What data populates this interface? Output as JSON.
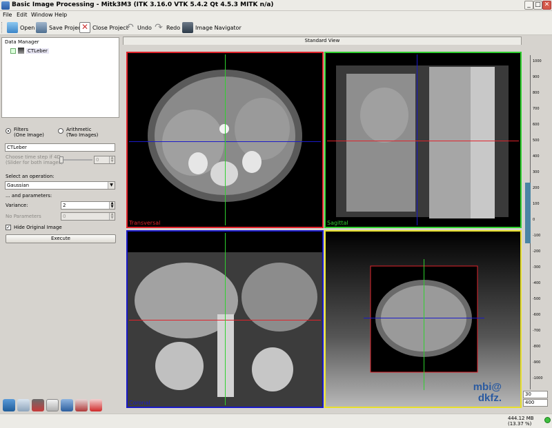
{
  "window": {
    "title": "Basic Image Processing - Mitk3M3 (ITK 3.16.0  VTK 5.4.2 Qt 4.5.3 MITK n/a)"
  },
  "menu": [
    "File",
    "Edit",
    "Window",
    "Help"
  ],
  "toolbar": {
    "open": "Open",
    "save_project": "Save Project",
    "close_project": "Close Project",
    "undo": "Undo",
    "redo": "Redo",
    "image_navigator": "Image Navigator"
  },
  "data_manager": {
    "title": "Data Manager",
    "items": [
      "CTLeber"
    ]
  },
  "operations": {
    "filters_label": "Filters",
    "filters_sub": "(One Image)",
    "arithmetic_label": "Arithmetic",
    "arithmetic_sub": "(Two Images)",
    "image_name": "CTLeber",
    "time_step_line1": "Choose time step if 4D",
    "time_step_line2": "(Slider for both images)",
    "time_step_value": "0",
    "select_operation": "Select an operation:",
    "operation_value": "Gaussian",
    "and_parameters": "... and parameters:",
    "variance_label": "Variance:",
    "variance_value": "2",
    "no_params_label": "No Parameters",
    "no_params_value": "0",
    "hide_original": "Hide Original Image",
    "hide_original_checked": true,
    "execute": "Execute"
  },
  "view": {
    "tab_label": "Standard View",
    "transversal": "Transversal",
    "sagittal": "Sagittal",
    "coronal": "Coronal",
    "logo_line1": "mbi@",
    "logo_line2": "dkfz.",
    "colors": {
      "transversal": "#e0232b",
      "sagittal": "#2fd02f",
      "coronal": "#1a1ac8",
      "threed": "#e8e02a"
    }
  },
  "level_window": {
    "ticks": [
      "1000",
      "900",
      "800",
      "700",
      "600",
      "500",
      "400",
      "300",
      "200",
      "100",
      "0",
      "-100",
      "-200",
      "-300",
      "-400",
      "-500",
      "-600",
      "-700",
      "-800",
      "-900",
      "-1000"
    ],
    "level": "30",
    "window": "400"
  },
  "status": {
    "memory": "444.12 MB (13.37 %)"
  }
}
